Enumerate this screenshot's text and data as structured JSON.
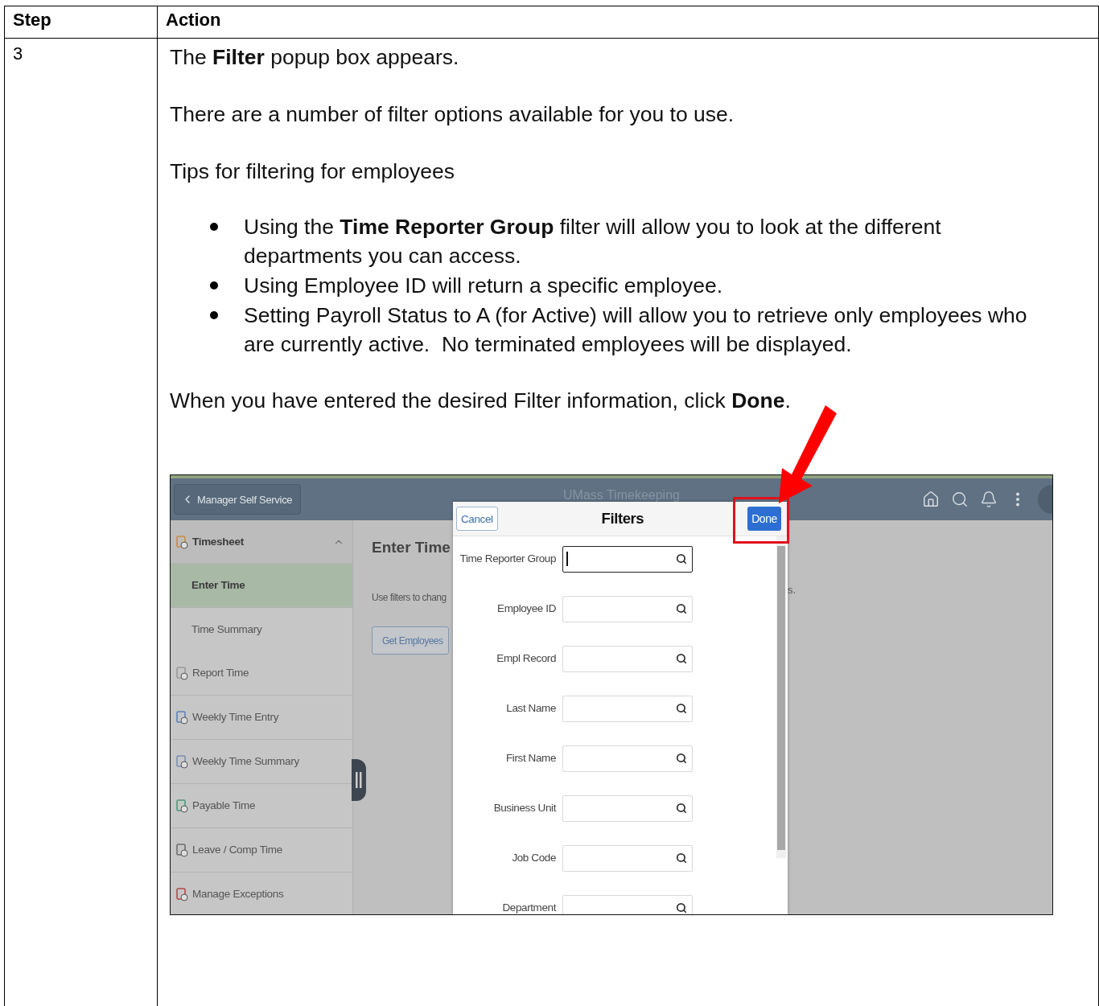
{
  "table": {
    "columns": [
      "Step",
      "Action"
    ],
    "row": {
      "step": "3",
      "intro": [
        "The **Filter** popup box appears.",
        "There are a number of filter options available for you to use.",
        "Tips for filtering for employees"
      ],
      "bullets": [
        "Using the **Time Reporter Group** filter will allow you to look at the different departments you can access.",
        "Using Employee ID will return a specific employee.",
        "Setting Payroll Status to A (for Active) will allow you to retrieve only employees who are currently active.  No terminated employees will be displayed."
      ],
      "closing": "When you have entered the desired Filter information, click **Done**.",
      "screenshot": {
        "header": {
          "back_button": "Manager Self Service",
          "title": "UMass Timekeeping"
        },
        "sidebar": {
          "items": [
            {
              "label": "Timesheet",
              "expanded": true,
              "children": [
                {
                  "label": "Enter Time",
                  "selected": true
                },
                {
                  "label": "Time Summary",
                  "selected": false
                }
              ]
            },
            {
              "label": "Report Time"
            },
            {
              "label": "Weekly Time Entry"
            },
            {
              "label": "Weekly Time Summary"
            },
            {
              "label": "Payable Time"
            },
            {
              "label": "Leave / Comp Time"
            },
            {
              "label": "Manage Exceptions"
            }
          ]
        },
        "main": {
          "heading": "Enter Time",
          "hint": "Use filters to chang",
          "hint_tail": "s.",
          "button": "Get Employees"
        },
        "modal": {
          "cancel": "Cancel",
          "title": "Filters",
          "done": "Done",
          "highlighted": true,
          "fields": [
            {
              "label": "Time Reporter Group",
              "focused": true
            },
            {
              "label": "Employee ID",
              "focused": false
            },
            {
              "label": "Empl Record",
              "focused": false
            },
            {
              "label": "Last Name",
              "focused": false
            },
            {
              "label": "First Name",
              "focused": false
            },
            {
              "label": "Business Unit",
              "focused": false
            },
            {
              "label": "Job Code",
              "focused": false
            },
            {
              "label": "Department",
              "focused": false
            }
          ]
        }
      }
    }
  }
}
